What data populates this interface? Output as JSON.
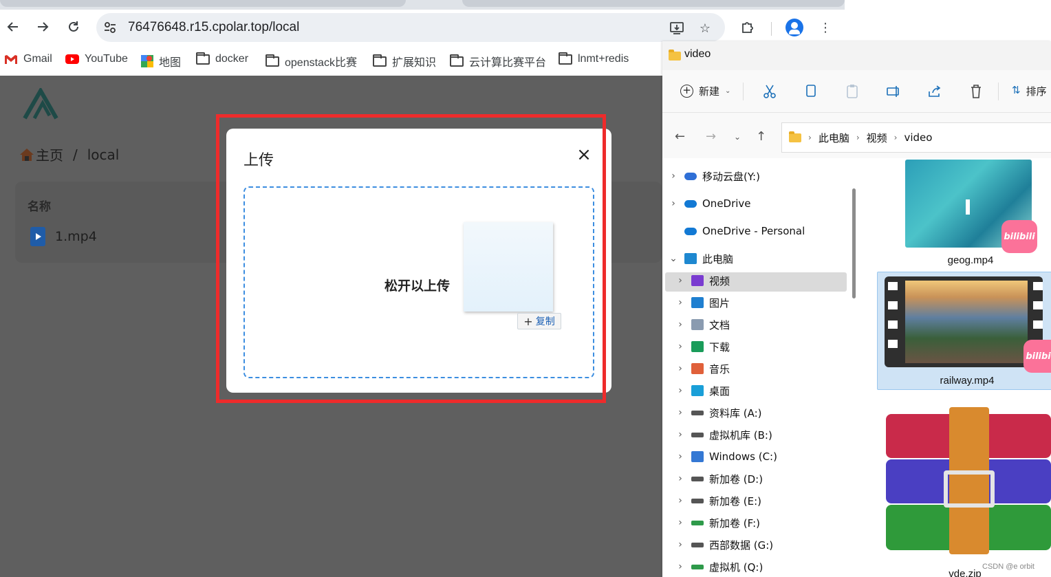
{
  "browser": {
    "url": "76476648.r15.cpolar.top/local",
    "bookmarks": [
      "Gmail",
      "YouTube",
      "地图",
      "docker",
      "openstack比赛",
      "扩展知识",
      "云计算比赛平台",
      "lnmt+redis"
    ]
  },
  "page": {
    "breadcrumb_home": "主页",
    "breadcrumb_sep": "/",
    "breadcrumb_current": "local",
    "column_name": "名称",
    "files": [
      "1.mp4"
    ]
  },
  "modal": {
    "title": "上传",
    "drop_text": "松开以上传",
    "copy_badge": "复制",
    "close_glyph": "×"
  },
  "explorer": {
    "title": "video",
    "toolbar_new": "新建",
    "toolbar_sort": "排序",
    "path": [
      "此电脑",
      "视频",
      "video"
    ],
    "tree": [
      {
        "label": "移动云盘(Y:)",
        "icon": "cloud-drive-icon",
        "color": "#2f6fd6"
      },
      {
        "label": "OneDrive",
        "icon": "onedrive-icon",
        "color": "#1279d4"
      },
      {
        "label": "OneDrive - Personal",
        "icon": "onedrive-icon",
        "color": "#1279d4"
      },
      {
        "label": "此电脑",
        "icon": "computer-icon",
        "color": "#1e88d0"
      },
      {
        "label": "视频",
        "icon": "video-folder-icon",
        "color": "#7a3cd0"
      },
      {
        "label": "图片",
        "icon": "pictures-icon",
        "color": "#1f7fd0"
      },
      {
        "label": "文档",
        "icon": "documents-icon",
        "color": "#8a9bb0"
      },
      {
        "label": "下载",
        "icon": "download-icon",
        "color": "#1a9c5a"
      },
      {
        "label": "音乐",
        "icon": "music-icon",
        "color": "#e0603a"
      },
      {
        "label": "桌面",
        "icon": "desktop-icon",
        "color": "#1a9fd8"
      },
      {
        "label": "资料库 (A:)",
        "icon": "drive-icon",
        "color": "#555555"
      },
      {
        "label": "虚拟机库 (B:)",
        "icon": "drive-icon",
        "color": "#555555"
      },
      {
        "label": "Windows  (C:)",
        "icon": "windows-drive-icon",
        "color": "#3478d4"
      },
      {
        "label": "新加卷 (D:)",
        "icon": "drive-icon",
        "color": "#555555"
      },
      {
        "label": "新加卷 (E:)",
        "icon": "drive-icon",
        "color": "#555555"
      },
      {
        "label": "新加卷 (F:)",
        "icon": "drive-icon",
        "color": "#2e9a4a"
      },
      {
        "label": "西部数据 (G:)",
        "icon": "drive-icon",
        "color": "#555555"
      },
      {
        "label": "虚拟机 (Q:)",
        "icon": "drive-icon",
        "color": "#2e9a4a"
      }
    ],
    "files": [
      {
        "name": "geog.mp4"
      },
      {
        "name": "railway.mp4"
      },
      {
        "name": "vde.zip"
      }
    ],
    "badge_text": "bilibili"
  },
  "watermark": "CSDN @e orbit"
}
